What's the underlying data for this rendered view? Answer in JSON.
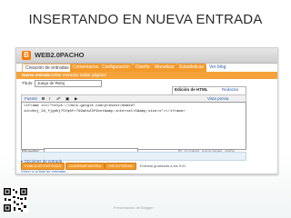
{
  "slide": {
    "title": "INSERTANDO EN NUEVA ENTRADA",
    "footer": "Presentación de Blogger"
  },
  "blogger": {
    "logo_letter": "B",
    "blog_name": "WEB2.0PACHO",
    "tabs": [
      "Creación de entradas",
      "Comentarios",
      "Configuración",
      "Diseño",
      "Monetizar",
      "Estadísticas",
      "Ver blog"
    ],
    "subtabs": [
      "Nueva entrada",
      "Editar entradas",
      "Editar páginas"
    ],
    "title_label": "Título:",
    "title_value": "Juego de Reloj",
    "edit_html_label": "Edición de HTML",
    "compose_label": "Redactar",
    "toolbar": {
      "font_label": "Fuente",
      "bold": "B",
      "italic": "I",
      "preview": "Vista previa"
    },
    "code_lines": [
      "<iframe src=\"https://docs.google.com/present/embed?",
      "id=dhvj_34_fjgdhj75fq6fr7d9abs23f9cnt&amp;interval=5&amp;size=s\"></iframe>"
    ],
    "labels_text": "Etiquetas:",
    "labels_hint": "Ej: scooters, vacaciones, otoño",
    "options_link": "▸ Opciones de entrada",
    "buttons": [
      "PUBLICAR ENTRADA",
      "GUARDAR AHORA",
      "VISTA PREVIA"
    ],
    "saved_text": "Entrada guardada a las 9:41",
    "back_link": "Volver a la lista de entradas"
  },
  "colors": {
    "accent": "#f39a2b",
    "title_text": "#2a2a2a"
  }
}
